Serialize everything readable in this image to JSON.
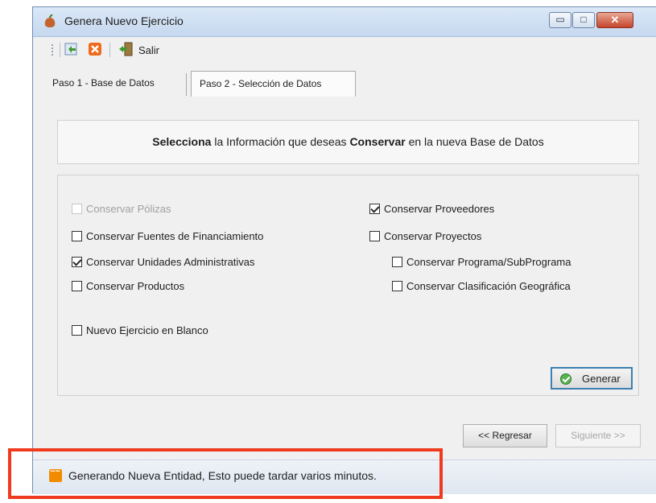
{
  "window": {
    "title": "Genera Nuevo Ejercicio"
  },
  "window_controls": {
    "minimize": "▭",
    "maximize": "□",
    "close": "✕"
  },
  "toolbar": {
    "exit_label": "Salir"
  },
  "tabs": [
    {
      "label": "Paso 1 - Base de Datos"
    },
    {
      "label": "Paso 2 - Selección de Datos"
    }
  ],
  "header": {
    "part1": "Selecciona",
    "part2": " la Información que deseas ",
    "part3": "Conservar",
    "part4": "  en la nueva Base de Datos"
  },
  "options": {
    "polizas": {
      "label": "Conservar Pólizas",
      "checked": false
    },
    "fuentes": {
      "label": "Conservar Fuentes de Financiamiento",
      "checked": false
    },
    "unidades": {
      "label": "Conservar Unidades Administrativas",
      "checked": true
    },
    "productos": {
      "label": "Conservar Productos",
      "checked": false
    },
    "proveedores": {
      "label": "Conservar Proveedores",
      "checked": true
    },
    "proyectos": {
      "label": "Conservar Proyectos",
      "checked": false
    },
    "programa": {
      "label": "Conservar Programa/SubPrograma",
      "checked": false
    },
    "clasificacion": {
      "label": "Conservar Clasificación Geográfica",
      "checked": false
    },
    "nuevo_blanco": {
      "label": "Nuevo Ejercicio en Blanco",
      "checked": false
    }
  },
  "buttons": {
    "generar": "Generar",
    "regresar": "<< Regresar",
    "siguiente": "Siguiente >>"
  },
  "status": {
    "text": "Generando Nueva Entidad, Esto puede tardar varios minutos."
  },
  "colors": {
    "highlight": "#ef3a1e",
    "accent": "#3c7fb1",
    "status_icon": "#f28b00"
  }
}
